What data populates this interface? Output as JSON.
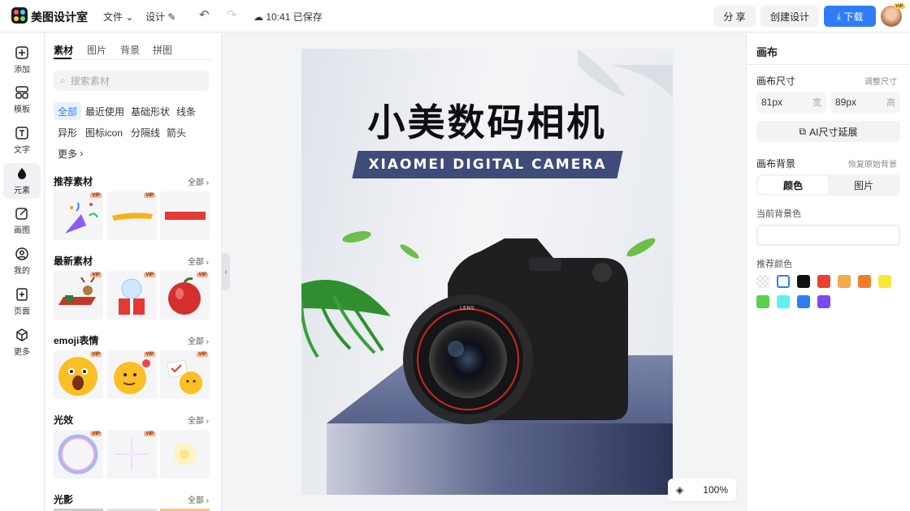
{
  "app": {
    "name": "美图设计室",
    "menu_file": "文件",
    "menu_design": "设计",
    "saved_status": "10:41 已保存"
  },
  "header": {
    "share": "分 享",
    "create": "创建设计",
    "download": "下载",
    "avatar_badge": "VIP"
  },
  "rail": [
    {
      "label": "添加",
      "icon": "plus-square-icon"
    },
    {
      "label": "模板",
      "icon": "template-icon"
    },
    {
      "label": "文字",
      "icon": "text-icon"
    },
    {
      "label": "元素",
      "icon": "shapes-icon"
    },
    {
      "label": "画图",
      "icon": "draw-icon"
    },
    {
      "label": "我的",
      "icon": "user-icon"
    },
    {
      "label": "页面",
      "icon": "add-page-icon"
    },
    {
      "label": "更多",
      "icon": "cube-icon"
    }
  ],
  "panel": {
    "tabs": [
      "素材",
      "图片",
      "背景",
      "拼图"
    ],
    "search_placeholder": "搜索素材",
    "chips": [
      "全部",
      "最近使用",
      "基础形状",
      "线条",
      "异形",
      "图标icon",
      "分隔线",
      "箭头",
      "更多"
    ],
    "sections": [
      {
        "title": "推荐素材",
        "all": "全部"
      },
      {
        "title": "最新素材",
        "all": "全部"
      },
      {
        "title": "emoji表情",
        "all": "全部"
      },
      {
        "title": "光效",
        "all": "全部"
      },
      {
        "title": "光影",
        "all": "全部"
      }
    ],
    "vip_label": "VIP"
  },
  "canvas": {
    "title": "小美数码相机",
    "subtitle": "XIAOMEI DIGITAL CAMERA",
    "lens_text": "LENS",
    "zoom": "100%"
  },
  "right": {
    "heading": "画布",
    "size_label": "画布尺寸",
    "size_link": "调整尺寸",
    "width_value": "81px",
    "width_unit": "宽",
    "height_value": "89px",
    "height_unit": "高",
    "ai_button": "AI尺寸延展",
    "bg_label": "画布背景",
    "bg_reset": "恢复原始背景",
    "seg_color": "颜色",
    "seg_image": "图片",
    "current_bg": "当前背景色",
    "recommended": "推荐颜色",
    "swatches": [
      "#ffffff",
      "#111111",
      "#e8412c",
      "#f4a94a",
      "#ef7d2e",
      "#f7e93c",
      "#5ad14b",
      "#5ff0f0",
      "#2f7df6",
      "#7b4bf0"
    ]
  },
  "colors": {
    "accent": "#2f7df6",
    "poster_band": "#3f4b78"
  }
}
